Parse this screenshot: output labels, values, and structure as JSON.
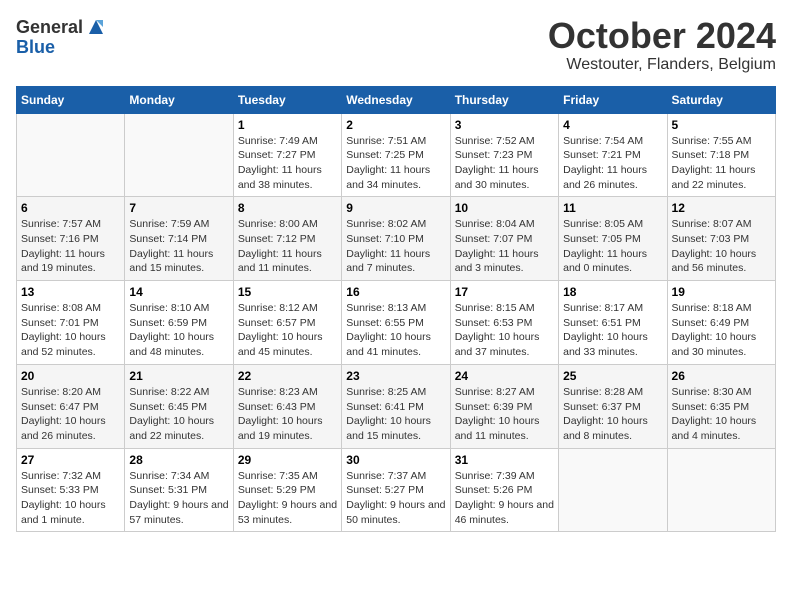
{
  "header": {
    "logo_general": "General",
    "logo_blue": "Blue",
    "month": "October 2024",
    "location": "Westouter, Flanders, Belgium"
  },
  "days_of_week": [
    "Sunday",
    "Monday",
    "Tuesday",
    "Wednesday",
    "Thursday",
    "Friday",
    "Saturday"
  ],
  "weeks": [
    [
      {
        "day": "",
        "info": ""
      },
      {
        "day": "",
        "info": ""
      },
      {
        "day": "1",
        "info": "Sunrise: 7:49 AM\nSunset: 7:27 PM\nDaylight: 11 hours and 38 minutes."
      },
      {
        "day": "2",
        "info": "Sunrise: 7:51 AM\nSunset: 7:25 PM\nDaylight: 11 hours and 34 minutes."
      },
      {
        "day": "3",
        "info": "Sunrise: 7:52 AM\nSunset: 7:23 PM\nDaylight: 11 hours and 30 minutes."
      },
      {
        "day": "4",
        "info": "Sunrise: 7:54 AM\nSunset: 7:21 PM\nDaylight: 11 hours and 26 minutes."
      },
      {
        "day": "5",
        "info": "Sunrise: 7:55 AM\nSunset: 7:18 PM\nDaylight: 11 hours and 22 minutes."
      }
    ],
    [
      {
        "day": "6",
        "info": "Sunrise: 7:57 AM\nSunset: 7:16 PM\nDaylight: 11 hours and 19 minutes."
      },
      {
        "day": "7",
        "info": "Sunrise: 7:59 AM\nSunset: 7:14 PM\nDaylight: 11 hours and 15 minutes."
      },
      {
        "day": "8",
        "info": "Sunrise: 8:00 AM\nSunset: 7:12 PM\nDaylight: 11 hours and 11 minutes."
      },
      {
        "day": "9",
        "info": "Sunrise: 8:02 AM\nSunset: 7:10 PM\nDaylight: 11 hours and 7 minutes."
      },
      {
        "day": "10",
        "info": "Sunrise: 8:04 AM\nSunset: 7:07 PM\nDaylight: 11 hours and 3 minutes."
      },
      {
        "day": "11",
        "info": "Sunrise: 8:05 AM\nSunset: 7:05 PM\nDaylight: 11 hours and 0 minutes."
      },
      {
        "day": "12",
        "info": "Sunrise: 8:07 AM\nSunset: 7:03 PM\nDaylight: 10 hours and 56 minutes."
      }
    ],
    [
      {
        "day": "13",
        "info": "Sunrise: 8:08 AM\nSunset: 7:01 PM\nDaylight: 10 hours and 52 minutes."
      },
      {
        "day": "14",
        "info": "Sunrise: 8:10 AM\nSunset: 6:59 PM\nDaylight: 10 hours and 48 minutes."
      },
      {
        "day": "15",
        "info": "Sunrise: 8:12 AM\nSunset: 6:57 PM\nDaylight: 10 hours and 45 minutes."
      },
      {
        "day": "16",
        "info": "Sunrise: 8:13 AM\nSunset: 6:55 PM\nDaylight: 10 hours and 41 minutes."
      },
      {
        "day": "17",
        "info": "Sunrise: 8:15 AM\nSunset: 6:53 PM\nDaylight: 10 hours and 37 minutes."
      },
      {
        "day": "18",
        "info": "Sunrise: 8:17 AM\nSunset: 6:51 PM\nDaylight: 10 hours and 33 minutes."
      },
      {
        "day": "19",
        "info": "Sunrise: 8:18 AM\nSunset: 6:49 PM\nDaylight: 10 hours and 30 minutes."
      }
    ],
    [
      {
        "day": "20",
        "info": "Sunrise: 8:20 AM\nSunset: 6:47 PM\nDaylight: 10 hours and 26 minutes."
      },
      {
        "day": "21",
        "info": "Sunrise: 8:22 AM\nSunset: 6:45 PM\nDaylight: 10 hours and 22 minutes."
      },
      {
        "day": "22",
        "info": "Sunrise: 8:23 AM\nSunset: 6:43 PM\nDaylight: 10 hours and 19 minutes."
      },
      {
        "day": "23",
        "info": "Sunrise: 8:25 AM\nSunset: 6:41 PM\nDaylight: 10 hours and 15 minutes."
      },
      {
        "day": "24",
        "info": "Sunrise: 8:27 AM\nSunset: 6:39 PM\nDaylight: 10 hours and 11 minutes."
      },
      {
        "day": "25",
        "info": "Sunrise: 8:28 AM\nSunset: 6:37 PM\nDaylight: 10 hours and 8 minutes."
      },
      {
        "day": "26",
        "info": "Sunrise: 8:30 AM\nSunset: 6:35 PM\nDaylight: 10 hours and 4 minutes."
      }
    ],
    [
      {
        "day": "27",
        "info": "Sunrise: 7:32 AM\nSunset: 5:33 PM\nDaylight: 10 hours and 1 minute."
      },
      {
        "day": "28",
        "info": "Sunrise: 7:34 AM\nSunset: 5:31 PM\nDaylight: 9 hours and 57 minutes."
      },
      {
        "day": "29",
        "info": "Sunrise: 7:35 AM\nSunset: 5:29 PM\nDaylight: 9 hours and 53 minutes."
      },
      {
        "day": "30",
        "info": "Sunrise: 7:37 AM\nSunset: 5:27 PM\nDaylight: 9 hours and 50 minutes."
      },
      {
        "day": "31",
        "info": "Sunrise: 7:39 AM\nSunset: 5:26 PM\nDaylight: 9 hours and 46 minutes."
      },
      {
        "day": "",
        "info": ""
      },
      {
        "day": "",
        "info": ""
      }
    ]
  ]
}
